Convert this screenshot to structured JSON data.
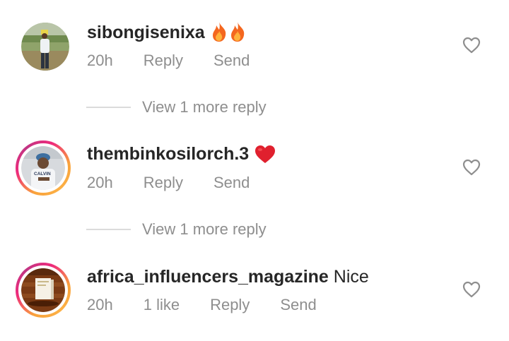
{
  "comments": [
    {
      "username": "sibongisenixa",
      "text": "",
      "emoji": "fire-fire",
      "time": "20h",
      "likes": "",
      "reply_label": "Reply",
      "send_label": "Send",
      "avatar_ring": false
    },
    {
      "username": "thembinkosilorch.3",
      "text": "",
      "emoji": "red-heart",
      "time": "20h",
      "likes": "",
      "reply_label": "Reply",
      "send_label": "Send",
      "avatar_ring": true,
      "avatar_shirt_text": "CALVIN"
    },
    {
      "username": "africa_influencers_magazine",
      "text": "Nice",
      "emoji": "",
      "time": "20h",
      "likes": "1 like",
      "reply_label": "Reply",
      "send_label": "Send",
      "avatar_ring": true
    }
  ],
  "view_more": [
    {
      "label": "View 1 more reply"
    },
    {
      "label": "View 1 more reply"
    }
  ],
  "colors": {
    "text": "#262626",
    "secondary": "#8e8e8e",
    "divider": "#dbdbdb",
    "heart_emoji": "#e0202e",
    "fire": "#f4671f"
  }
}
